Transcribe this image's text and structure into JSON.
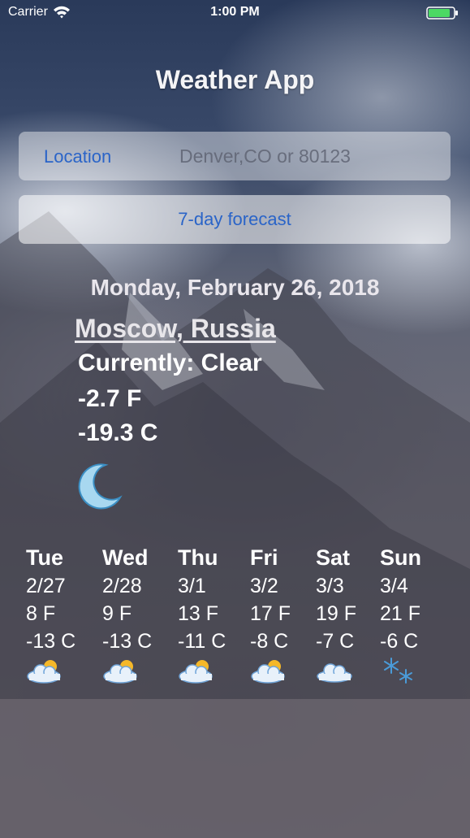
{
  "status_bar": {
    "carrier": "Carrier",
    "time": "1:00 PM"
  },
  "app": {
    "title": "Weather App"
  },
  "location": {
    "label": "Location",
    "placeholder": "Denver,CO or 80123",
    "value": ""
  },
  "forecast_button": {
    "label": "7-day forecast"
  },
  "current": {
    "date": "Monday, February 26, 2018",
    "city": "Moscow, Russia",
    "conditions": "Currently: Clear",
    "temp_f": "-2.7 F",
    "temp_c": "-19.3 C",
    "icon": "moon-icon"
  },
  "forecast": [
    {
      "day": "Tue",
      "date": "2/27",
      "temp_f": "8 F",
      "temp_c": "-13 C",
      "icon": "partly-cloudy-icon"
    },
    {
      "day": "Wed",
      "date": "2/28",
      "temp_f": "9 F",
      "temp_c": "-13 C",
      "icon": "partly-cloudy-icon"
    },
    {
      "day": "Thu",
      "date": "3/1",
      "temp_f": "13 F",
      "temp_c": "-11 C",
      "icon": "partly-cloudy-icon"
    },
    {
      "day": "Fri",
      "date": "3/2",
      "temp_f": "17 F",
      "temp_c": "-8 C",
      "icon": "partly-cloudy-icon"
    },
    {
      "day": "Sat",
      "date": "3/3",
      "temp_f": "19 F",
      "temp_c": "-7 C",
      "icon": "cloud-icon"
    },
    {
      "day": "Sun",
      "date": "3/4",
      "temp_f": "21 F",
      "temp_c": "-6 C",
      "icon": "snowflake-icon"
    }
  ],
  "colors": {
    "accent": "#2a64c8",
    "battery": "#4cd964"
  }
}
